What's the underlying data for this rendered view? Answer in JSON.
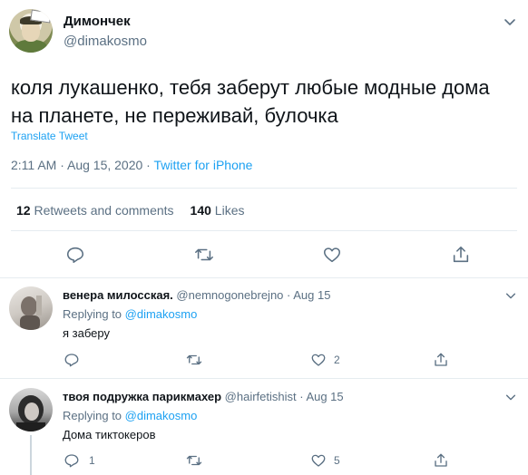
{
  "tweet": {
    "author_name": "Димончек",
    "author_handle": "@dimakosmo",
    "text_line1": "коля лукашенко, тебя заберут любые модные дома",
    "text_line2": "на планете, не переживай, булочка",
    "translate_label": "Translate Tweet",
    "time": "2:11 AM · Aug 15, 2020 · ",
    "source": "Twitter for iPhone",
    "retweets_count": "12",
    "retweets_label": "Retweets and comments",
    "likes_count": "140",
    "likes_label": "Likes"
  },
  "replies": [
    {
      "name": "венера милосская.",
      "handle_date": "@nemnogonebrejno · Aug 15",
      "replying_prefix": "Replying to ",
      "replying_to": "@dimakosmo",
      "text": "я заберу",
      "reply_count": "",
      "retweet_count": "",
      "like_count": "2"
    },
    {
      "name": "твоя подружка парикмахер",
      "handle_date": "@hairfetishist · Aug 15",
      "replying_prefix": "Replying to ",
      "replying_to": "@dimakosmo",
      "text": "Дома тиктокеров",
      "reply_count": "1",
      "retweet_count": "",
      "like_count": "5"
    }
  ],
  "colors": {
    "accent": "#1da1f2",
    "muted": "#5b7083",
    "divider": "#e6ecf0"
  },
  "icons": [
    "reply-icon",
    "retweet-icon",
    "like-icon",
    "share-icon",
    "chevron-down-icon"
  ]
}
